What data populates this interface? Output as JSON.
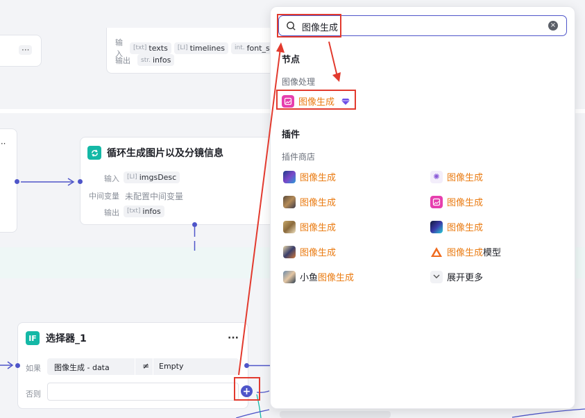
{
  "canvas": {
    "top_node": {
      "rows": [
        {
          "label": "输入",
          "chips": [
            {
              "type": "[txt]",
              "name": "texts"
            },
            {
              "type": "[LI]",
              "name": "timelines"
            },
            {
              "type": "int.",
              "name": "font_size"
            }
          ]
        },
        {
          "label": "输出",
          "chips": [
            {
              "type": "str.",
              "name": "infos"
            }
          ]
        }
      ]
    },
    "loop_node": {
      "title": "循环生成图片以及分镜信息",
      "input_label": "输入",
      "input_chip_type": "[LI]",
      "input_chip": "imgsDesc",
      "mid_label": "中间变量",
      "mid_value": "未配置中间变量",
      "output_label": "输出",
      "output_chip_type": "[txt]",
      "output_chip": "infos"
    },
    "selector_node": {
      "icon_text": "IF",
      "title": "选择器_1",
      "more": "···",
      "if_label": "如果",
      "cond_left": "图像生成 - data",
      "cond_op": "≠",
      "cond_right": "Empty",
      "else_label": "否则"
    },
    "left_more": "···"
  },
  "panel": {
    "search_value": "图像生成",
    "section_nodes": "节点",
    "group_image": "图像处理",
    "node_item": "图像生成",
    "section_plugins": "插件",
    "group_store": "插件商店",
    "plugins_left": [
      {
        "prefix": "",
        "hl": "图像生成",
        "suffix": ""
      },
      {
        "prefix": "",
        "hl": "图像生成",
        "suffix": ""
      },
      {
        "prefix": "",
        "hl": "图像生成",
        "suffix": ""
      },
      {
        "prefix": "",
        "hl": "图像生成",
        "suffix": ""
      },
      {
        "prefix": "小鱼",
        "hl": "图像生成",
        "suffix": ""
      }
    ],
    "plugins_right": [
      {
        "prefix": "",
        "hl": "图像生成",
        "suffix": ""
      },
      {
        "prefix": "",
        "hl": "图像生成",
        "suffix": ""
      },
      {
        "prefix": "",
        "hl": "图像生成",
        "suffix": ""
      },
      {
        "prefix": "",
        "hl": "图像生成",
        "suffix": "模型"
      }
    ],
    "expand_more": "展开更多"
  },
  "colors": {
    "accent": "#4e55c9",
    "highlight": "#ea7b12",
    "annotation": "#e23a2e",
    "teal": "#14b8a6"
  }
}
